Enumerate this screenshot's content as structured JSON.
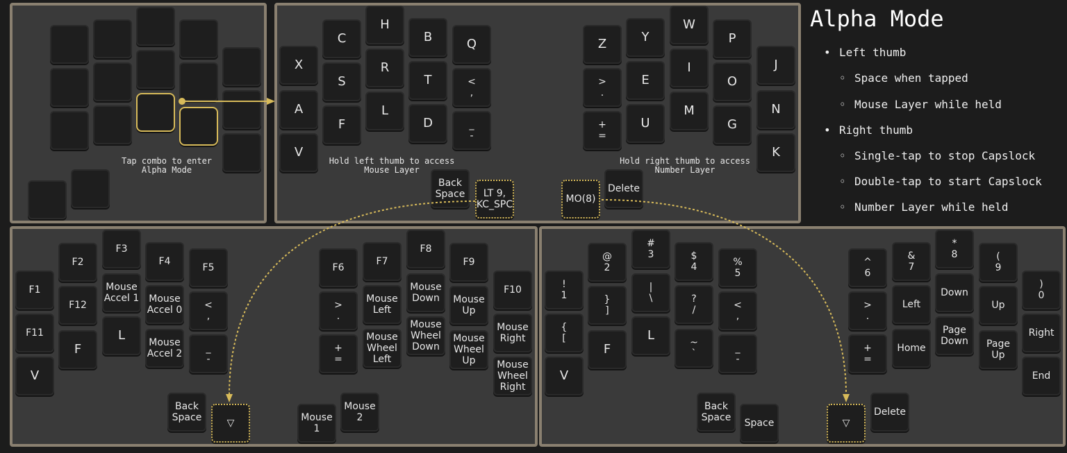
{
  "legend": {
    "title": "Alpha Mode",
    "items": [
      {
        "text": "Left thumb",
        "sub": false
      },
      {
        "text": "Space when tapped",
        "sub": true
      },
      {
        "text": "Mouse Layer while held",
        "sub": true
      },
      {
        "text": "Right thumb",
        "sub": false
      },
      {
        "text": "Single-tap to stop Capslock",
        "sub": true
      },
      {
        "text": "Double-tap to start Capslock",
        "sub": true
      },
      {
        "text": "Number Layer while held",
        "sub": true
      }
    ]
  },
  "captions": {
    "combo": "Tap combo to enter\nAlpha Mode",
    "hold_left": "Hold left thumb to access\nMouse Layer",
    "hold_right": "Hold right thumb to access\nNumber Layer"
  },
  "panel_combo": {
    "keys": [
      "",
      "",
      "",
      "",
      "",
      "",
      "",
      "",
      "",
      "",
      "",
      "",
      "",
      "",
      "",
      "",
      "",
      "",
      ""
    ]
  },
  "panel_alpha": {
    "keys": [
      "X",
      "A",
      "V",
      "C",
      "S",
      "F",
      "H",
      "R",
      "L",
      "B",
      "T",
      "D",
      "Q",
      "<\n,",
      "_\n-",
      "Back\nSpace",
      "LT 9,\nKC_SPC",
      "Z",
      ">\n.",
      "+\n=",
      "Y",
      "E",
      "U",
      "W",
      "I",
      "M",
      "P",
      "O",
      "G",
      "J",
      "N",
      "K",
      "MO(8)",
      "Delete"
    ]
  },
  "panel_mouse": {
    "keys": [
      "F1",
      "F11",
      "V",
      "F2",
      "F12",
      "F",
      "F3",
      "Mouse\nAccel 1",
      "L",
      "F4",
      "Mouse\nAccel 0",
      "Mouse\nAccel 2",
      "F5",
      "<\n,",
      "_\n-",
      "Back\nSpace",
      "▽",
      "F6",
      ">\n.",
      "+\n=",
      "F7",
      "Mouse\nLeft",
      "Mouse\nWheel\nLeft",
      "F8",
      "Mouse\nDown",
      "Mouse\nWheel\nDown",
      "F9",
      "Mouse\nUp",
      "Mouse\nWheel\nUp",
      "F10",
      "Mouse\nRight",
      "Mouse\nWheel\nRight",
      "Mouse\n1",
      "Mouse\n2"
    ]
  },
  "panel_number": {
    "keys": [
      "!\n1",
      "{\n[",
      "V",
      "@\n2",
      "}\n]",
      "F",
      "#\n3",
      "|\n\\",
      "L",
      "$\n4",
      "?\n/",
      "~\n`",
      "%\n5",
      "<\n,",
      "_\n-",
      "Back\nSpace",
      "Space",
      "^\n6",
      ">\n.",
      "+\n=",
      "&\n7",
      "Left",
      "Home",
      "*\n8",
      "Down",
      "Page\nDown",
      "(\n9",
      "Up",
      "Page\nUp",
      ")\n0",
      "Right",
      "End",
      "▽",
      "Delete"
    ]
  },
  "colors": {
    "accent": "#d8bb5a",
    "panel_border": "#8a8070",
    "panel_bg": "#3a3a3a",
    "key_bg": "#1e1e1e"
  }
}
